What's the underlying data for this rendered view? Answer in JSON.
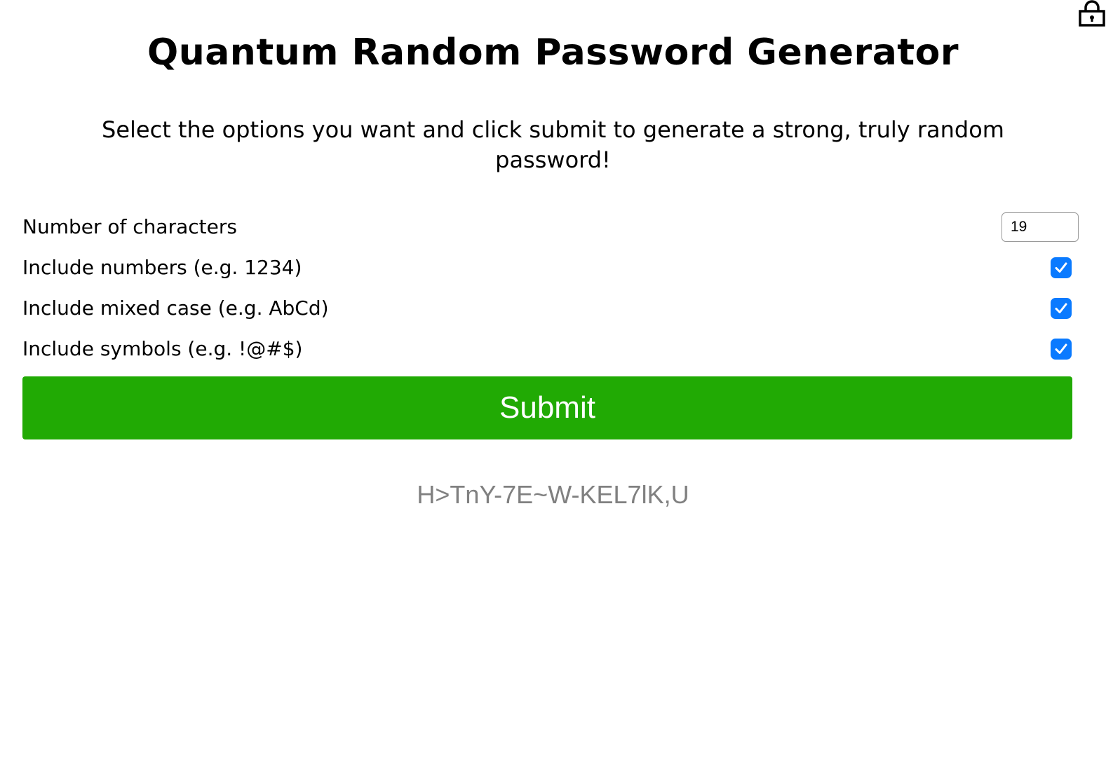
{
  "header": {
    "title": "Quantum Random Password Generator",
    "subtitle": "Select the options you want and click submit to generate a strong, truly random password!",
    "icon": "lock-icon"
  },
  "options": {
    "characters": {
      "label": "Number of characters",
      "value": "19"
    },
    "numbers": {
      "label": "Include numbers (e.g. 1234)",
      "checked": true
    },
    "mixed_case": {
      "label": "Include mixed case (e.g. AbCd)",
      "checked": true
    },
    "symbols": {
      "label": "Include symbols (e.g. !@#$)",
      "checked": true
    }
  },
  "submit": {
    "label": "Submit"
  },
  "result": {
    "password": "H>TnY-7E~W-KEL7lK,U"
  },
  "colors": {
    "submit_bg": "#21aa04",
    "checkbox_bg": "#0a7aff",
    "password_text": "#808080"
  }
}
